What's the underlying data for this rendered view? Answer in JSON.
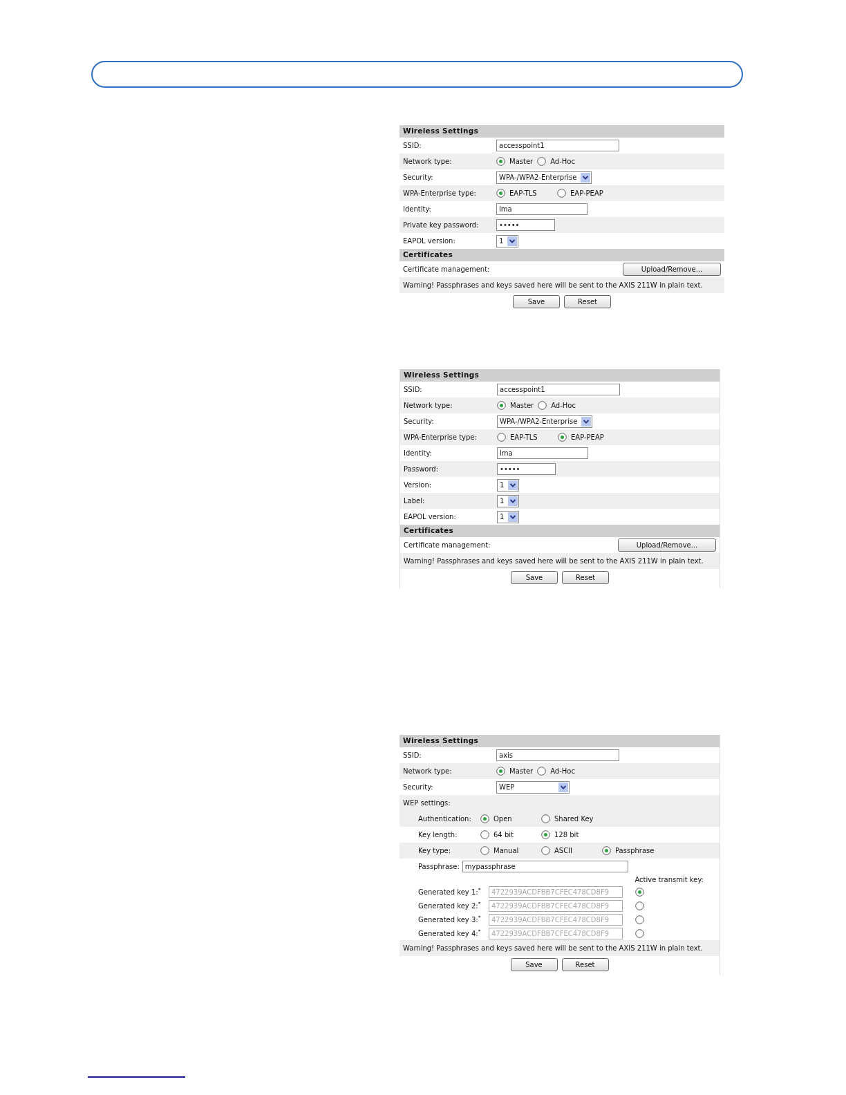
{
  "panels": [
    {
      "rows": [
        {
          "kind": "header",
          "title": "Wireless Settings"
        },
        {
          "kind": "text",
          "label": "SSID:",
          "value": "accesspoint1"
        },
        {
          "kind": "radios",
          "label": "Network type:",
          "options": [
            {
              "label": "Master",
              "selected": true
            },
            {
              "label": "Ad-Hoc",
              "selected": false
            }
          ]
        },
        {
          "kind": "select",
          "label": "Security:",
          "value": "WPA-/WPA2-Enterprise"
        },
        {
          "kind": "radios",
          "label": "WPA-Enterprise type:",
          "options": [
            {
              "label": "EAP-TLS",
              "selected": true
            },
            {
              "label": "EAP-PEAP",
              "selected": false
            }
          ]
        },
        {
          "kind": "text",
          "label": "Identity:",
          "value": "lma"
        },
        {
          "kind": "password",
          "label": "Private key password:",
          "value": "•••••"
        },
        {
          "kind": "select",
          "label": "EAPOL version:",
          "value": "1"
        },
        {
          "kind": "header",
          "title": "Certificates"
        },
        {
          "kind": "button",
          "label": "Certificate management:",
          "button": "Upload/Remove..."
        },
        {
          "kind": "note",
          "text": "Warning! Passphrases and keys saved here will be sent to the AXIS 211W in plain text."
        }
      ],
      "buttons": [
        "Save",
        "Reset"
      ]
    },
    {
      "rows": [
        {
          "kind": "header",
          "title": "Wireless Settings"
        },
        {
          "kind": "text",
          "label": "SSID:",
          "value": "accesspoint1"
        },
        {
          "kind": "radios",
          "label": "Network type:",
          "options": [
            {
              "label": "Master",
              "selected": true
            },
            {
              "label": "Ad-Hoc",
              "selected": false
            }
          ]
        },
        {
          "kind": "select",
          "label": "Security:",
          "value": "WPA-/WPA2-Enterprise"
        },
        {
          "kind": "radios",
          "label": "WPA-Enterprise type:",
          "options": [
            {
              "label": "EAP-TLS",
              "selected": false
            },
            {
              "label": "EAP-PEAP",
              "selected": true
            }
          ]
        },
        {
          "kind": "text",
          "label": "Identity:",
          "value": "lma"
        },
        {
          "kind": "password",
          "label": "Password:",
          "value": "•••••"
        },
        {
          "kind": "select",
          "label": "Version:",
          "value": "1"
        },
        {
          "kind": "select",
          "label": "Label:",
          "value": "1"
        },
        {
          "kind": "select",
          "label": "EAPOL version:",
          "value": "1"
        },
        {
          "kind": "header",
          "title": "Certificates"
        },
        {
          "kind": "button",
          "label": "Certificate management:",
          "button": "Upload/Remove..."
        },
        {
          "kind": "note",
          "text": "Warning! Passphrases and keys saved here will be sent to the AXIS 211W in plain text."
        }
      ],
      "buttons": [
        "Save",
        "Reset"
      ]
    },
    {
      "rows": [
        {
          "kind": "header",
          "title": "Wireless Settings"
        },
        {
          "kind": "text",
          "label": "SSID:",
          "value": "axis"
        },
        {
          "kind": "radios",
          "label": "Network type:",
          "options": [
            {
              "label": "Master",
              "selected": true
            },
            {
              "label": "Ad-Hoc",
              "selected": false
            }
          ]
        },
        {
          "kind": "select",
          "label": "Security:",
          "value": "WEP"
        },
        {
          "kind": "subheading",
          "label": "WEP settings:"
        },
        {
          "kind": "subradios",
          "label": "Authentication:",
          "options": [
            {
              "label": "Open",
              "selected": true
            },
            {
              "label": "Shared Key",
              "selected": false
            }
          ]
        },
        {
          "kind": "subradios",
          "label": "Key length:",
          "options": [
            {
              "label": "64 bit",
              "selected": false
            },
            {
              "label": "128 bit",
              "selected": true
            }
          ]
        },
        {
          "kind": "subradios",
          "label": "Key type:",
          "options": [
            {
              "label": "Manual",
              "selected": false
            },
            {
              "label": "ASCII",
              "selected": false
            },
            {
              "label": "Passphrase",
              "selected": true
            }
          ]
        },
        {
          "kind": "passphrase",
          "label": "Passphrase:",
          "value": "mypassphrase"
        },
        {
          "kind": "caption",
          "text": "Active transmit key:"
        },
        {
          "kind": "key",
          "label": "Generated key 1:$^{*}$",
          "value": "4722939ACDFBB7CFEC478CD8F9",
          "selected": true
        },
        {
          "kind": "key",
          "label": "Generated key 2:$^{*}$",
          "value": "4722939ACDFBB7CFEC478CD8F9",
          "selected": false
        },
        {
          "kind": "key",
          "label": "Generated key 3:$^{*}$",
          "value": "4722939ACDFBB7CFEC478CD8F9",
          "selected": false
        },
        {
          "kind": "key",
          "label": "Generated key 4:$^{*}$",
          "value": "4722939ACDFBB7CFEC478CD8F9",
          "selected": false
        },
        {
          "kind": "note",
          "text": "Warning! Passphrases and keys saved here will be sent to the AXIS 211W in plain text."
        }
      ],
      "buttons": [
        "Save",
        "Reset"
      ]
    }
  ]
}
